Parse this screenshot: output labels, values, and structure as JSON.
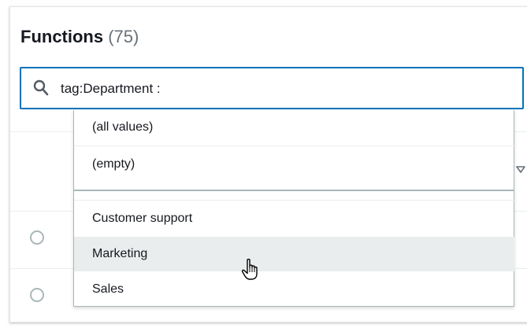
{
  "panel": {
    "title": "Functions",
    "count": "(75)"
  },
  "search": {
    "value": "tag:Department :",
    "icon": "search-icon"
  },
  "dropdown": {
    "options": [
      {
        "label": "(all values)"
      },
      {
        "label": "(empty)"
      },
      {
        "label": "Customer support"
      },
      {
        "label": "Marketing",
        "highlighted": true
      },
      {
        "label": "Sales"
      }
    ]
  },
  "colors": {
    "accent": "#0073bb",
    "highlight": "#eaeded",
    "text": "#16191f",
    "muted": "#687078"
  }
}
